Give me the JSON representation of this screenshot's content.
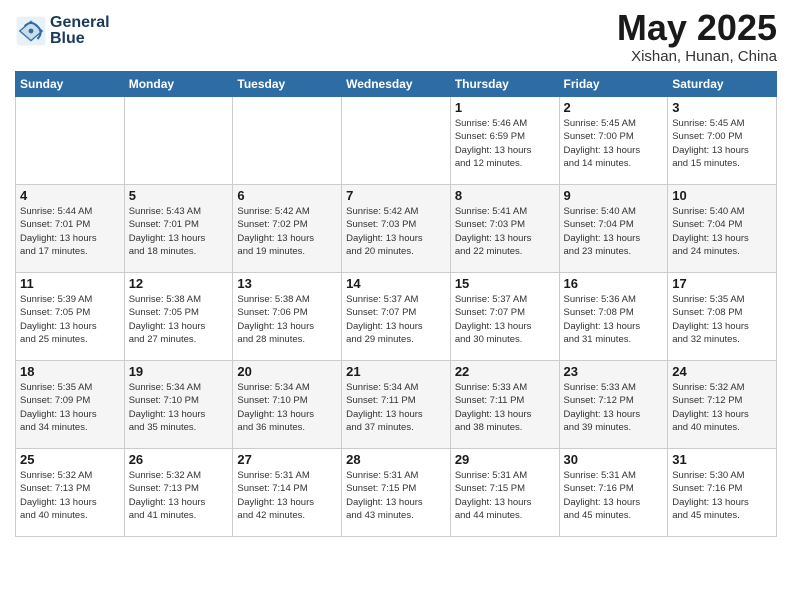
{
  "header": {
    "logo_line1": "General",
    "logo_line2": "Blue",
    "month_title": "May 2025",
    "location": "Xishan, Hunan, China"
  },
  "weekdays": [
    "Sunday",
    "Monday",
    "Tuesday",
    "Wednesday",
    "Thursday",
    "Friday",
    "Saturday"
  ],
  "rows": [
    [
      {
        "day": "",
        "info": ""
      },
      {
        "day": "",
        "info": ""
      },
      {
        "day": "",
        "info": ""
      },
      {
        "day": "",
        "info": ""
      },
      {
        "day": "1",
        "info": "Sunrise: 5:46 AM\nSunset: 6:59 PM\nDaylight: 13 hours\nand 12 minutes."
      },
      {
        "day": "2",
        "info": "Sunrise: 5:45 AM\nSunset: 7:00 PM\nDaylight: 13 hours\nand 14 minutes."
      },
      {
        "day": "3",
        "info": "Sunrise: 5:45 AM\nSunset: 7:00 PM\nDaylight: 13 hours\nand 15 minutes."
      }
    ],
    [
      {
        "day": "4",
        "info": "Sunrise: 5:44 AM\nSunset: 7:01 PM\nDaylight: 13 hours\nand 17 minutes."
      },
      {
        "day": "5",
        "info": "Sunrise: 5:43 AM\nSunset: 7:01 PM\nDaylight: 13 hours\nand 18 minutes."
      },
      {
        "day": "6",
        "info": "Sunrise: 5:42 AM\nSunset: 7:02 PM\nDaylight: 13 hours\nand 19 minutes."
      },
      {
        "day": "7",
        "info": "Sunrise: 5:42 AM\nSunset: 7:03 PM\nDaylight: 13 hours\nand 20 minutes."
      },
      {
        "day": "8",
        "info": "Sunrise: 5:41 AM\nSunset: 7:03 PM\nDaylight: 13 hours\nand 22 minutes."
      },
      {
        "day": "9",
        "info": "Sunrise: 5:40 AM\nSunset: 7:04 PM\nDaylight: 13 hours\nand 23 minutes."
      },
      {
        "day": "10",
        "info": "Sunrise: 5:40 AM\nSunset: 7:04 PM\nDaylight: 13 hours\nand 24 minutes."
      }
    ],
    [
      {
        "day": "11",
        "info": "Sunrise: 5:39 AM\nSunset: 7:05 PM\nDaylight: 13 hours\nand 25 minutes."
      },
      {
        "day": "12",
        "info": "Sunrise: 5:38 AM\nSunset: 7:05 PM\nDaylight: 13 hours\nand 27 minutes."
      },
      {
        "day": "13",
        "info": "Sunrise: 5:38 AM\nSunset: 7:06 PM\nDaylight: 13 hours\nand 28 minutes."
      },
      {
        "day": "14",
        "info": "Sunrise: 5:37 AM\nSunset: 7:07 PM\nDaylight: 13 hours\nand 29 minutes."
      },
      {
        "day": "15",
        "info": "Sunrise: 5:37 AM\nSunset: 7:07 PM\nDaylight: 13 hours\nand 30 minutes."
      },
      {
        "day": "16",
        "info": "Sunrise: 5:36 AM\nSunset: 7:08 PM\nDaylight: 13 hours\nand 31 minutes."
      },
      {
        "day": "17",
        "info": "Sunrise: 5:35 AM\nSunset: 7:08 PM\nDaylight: 13 hours\nand 32 minutes."
      }
    ],
    [
      {
        "day": "18",
        "info": "Sunrise: 5:35 AM\nSunset: 7:09 PM\nDaylight: 13 hours\nand 34 minutes."
      },
      {
        "day": "19",
        "info": "Sunrise: 5:34 AM\nSunset: 7:10 PM\nDaylight: 13 hours\nand 35 minutes."
      },
      {
        "day": "20",
        "info": "Sunrise: 5:34 AM\nSunset: 7:10 PM\nDaylight: 13 hours\nand 36 minutes."
      },
      {
        "day": "21",
        "info": "Sunrise: 5:34 AM\nSunset: 7:11 PM\nDaylight: 13 hours\nand 37 minutes."
      },
      {
        "day": "22",
        "info": "Sunrise: 5:33 AM\nSunset: 7:11 PM\nDaylight: 13 hours\nand 38 minutes."
      },
      {
        "day": "23",
        "info": "Sunrise: 5:33 AM\nSunset: 7:12 PM\nDaylight: 13 hours\nand 39 minutes."
      },
      {
        "day": "24",
        "info": "Sunrise: 5:32 AM\nSunset: 7:12 PM\nDaylight: 13 hours\nand 40 minutes."
      }
    ],
    [
      {
        "day": "25",
        "info": "Sunrise: 5:32 AM\nSunset: 7:13 PM\nDaylight: 13 hours\nand 40 minutes."
      },
      {
        "day": "26",
        "info": "Sunrise: 5:32 AM\nSunset: 7:13 PM\nDaylight: 13 hours\nand 41 minutes."
      },
      {
        "day": "27",
        "info": "Sunrise: 5:31 AM\nSunset: 7:14 PM\nDaylight: 13 hours\nand 42 minutes."
      },
      {
        "day": "28",
        "info": "Sunrise: 5:31 AM\nSunset: 7:15 PM\nDaylight: 13 hours\nand 43 minutes."
      },
      {
        "day": "29",
        "info": "Sunrise: 5:31 AM\nSunset: 7:15 PM\nDaylight: 13 hours\nand 44 minutes."
      },
      {
        "day": "30",
        "info": "Sunrise: 5:31 AM\nSunset: 7:16 PM\nDaylight: 13 hours\nand 45 minutes."
      },
      {
        "day": "31",
        "info": "Sunrise: 5:30 AM\nSunset: 7:16 PM\nDaylight: 13 hours\nand 45 minutes."
      }
    ]
  ]
}
